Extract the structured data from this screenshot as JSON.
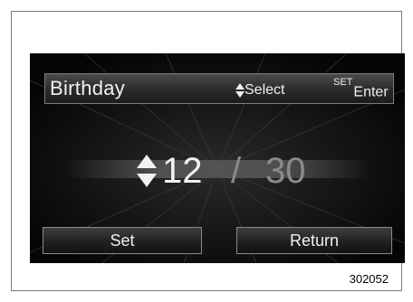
{
  "header": {
    "title": "Birthday",
    "select_hint": "Select",
    "enter_superscript": "SET",
    "enter_hint": "Enter"
  },
  "date": {
    "month": "12",
    "separator": "/",
    "day": "30"
  },
  "buttons": {
    "set_label": "Set",
    "return_label": "Return"
  },
  "figure_number": "302052",
  "icons": {
    "select": "up-down-arrows-icon",
    "date_adjust": "up-down-arrows-icon"
  },
  "colors": {
    "screen_background": "#060606",
    "text_active": "#f2f2f2",
    "text_inactive": "#8a8a8a",
    "border": "#7d7d7d"
  }
}
